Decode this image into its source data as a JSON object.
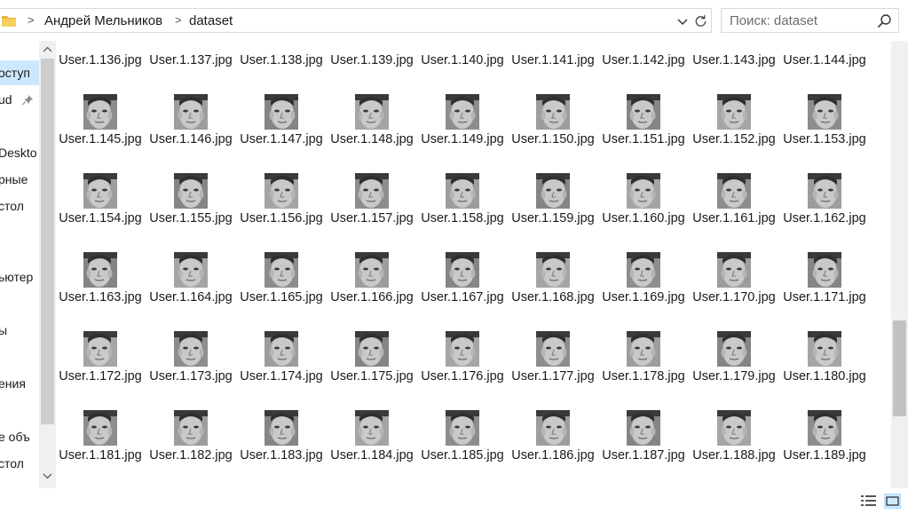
{
  "address": {
    "crumbs": [
      "Андрей Мельников",
      "dataset"
    ],
    "separator": ">"
  },
  "search": {
    "placeholder": "Поиск: dataset"
  },
  "nav": {
    "items": [
      {
        "label": "оступ",
        "selected": true
      },
      {
        "label": "ud",
        "pinned": true
      },
      {
        "label": "Deskto"
      },
      {
        "label": "рные"
      },
      {
        "label": "стол"
      },
      {
        "label": "ьютер"
      },
      {
        "label": "ы"
      },
      {
        "label": "ения"
      },
      {
        "label": "е объ"
      },
      {
        "label": "стол"
      }
    ]
  },
  "files": {
    "row_prefix_partial": [
      "User.1.136.jpg",
      "User.1.137.jpg",
      "User.1.138.jpg",
      "User.1.139.jpg",
      "User.1.140.jpg",
      "User.1.141.jpg",
      "User.1.142.jpg",
      "User.1.143.jpg",
      "User.1.144.jpg"
    ],
    "rows": [
      [
        "User.1.145.jpg",
        "User.1.146.jpg",
        "User.1.147.jpg",
        "User.1.148.jpg",
        "User.1.149.jpg",
        "User.1.150.jpg",
        "User.1.151.jpg",
        "User.1.152.jpg",
        "User.1.153.jpg"
      ],
      [
        "User.1.154.jpg",
        "User.1.155.jpg",
        "User.1.156.jpg",
        "User.1.157.jpg",
        "User.1.158.jpg",
        "User.1.159.jpg",
        "User.1.160.jpg",
        "User.1.161.jpg",
        "User.1.162.jpg"
      ],
      [
        "User.1.163.jpg",
        "User.1.164.jpg",
        "User.1.165.jpg",
        "User.1.166.jpg",
        "User.1.167.jpg",
        "User.1.168.jpg",
        "User.1.169.jpg",
        "User.1.170.jpg",
        "User.1.171.jpg"
      ],
      [
        "User.1.172.jpg",
        "User.1.173.jpg",
        "User.1.174.jpg",
        "User.1.175.jpg",
        "User.1.176.jpg",
        "User.1.177.jpg",
        "User.1.178.jpg",
        "User.1.179.jpg",
        "User.1.180.jpg"
      ],
      [
        "User.1.181.jpg",
        "User.1.182.jpg",
        "User.1.183.jpg",
        "User.1.184.jpg",
        "User.1.185.jpg",
        "User.1.186.jpg",
        "User.1.187.jpg",
        "User.1.188.jpg",
        "User.1.189.jpg"
      ]
    ]
  },
  "icons": {
    "folder": "folder-icon",
    "refresh": "refresh-icon",
    "search": "search-icon",
    "pin": "pin-icon",
    "details_view": "details-view-icon",
    "large_icons_view": "large-icons-view-icon"
  },
  "colors": {
    "selection": "#cce8ff",
    "folder": "#e8b53a"
  }
}
